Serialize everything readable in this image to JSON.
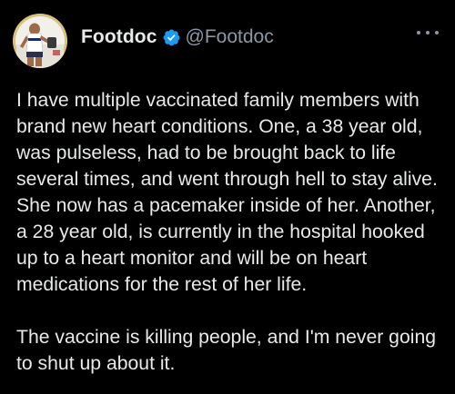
{
  "tweet": {
    "display_name": "Footdoc",
    "handle": "@Footdoc",
    "verified": true,
    "avatar_icon": "profile-photo",
    "more_icon": "more-options-icon",
    "paragraphs": [
      "I have multiple vaccinated family members with brand new heart conditions. One, a 38 year old, was pulseless, had to be brought back to life several times, and went through hell to stay alive. She now has a pacemaker inside of her. Another, a 28 year old, is currently in the hospital hooked up to a heart monitor and will be on heart medications for the rest of her life.",
      "The vaccine is killing people, and I'm never going to shut up about it."
    ]
  },
  "colors": {
    "background": "#000000",
    "text": "#e7e9ea",
    "secondary_text": "#8b98a5",
    "verified_badge": "#1d9bf0",
    "avatar_ring": "#d9c27a"
  }
}
